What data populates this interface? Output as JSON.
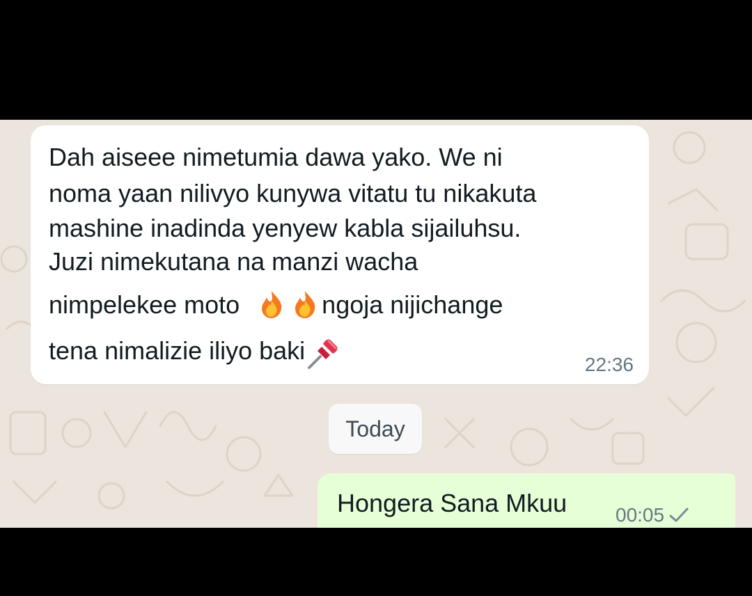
{
  "conversation": {
    "incoming": {
      "lines": [
        "Dah aiseee nimetumia dawa yako. We ni",
        "noma yaan nilivyo kunywa vitatu tu nikakuta",
        "mashine inadinda yenyew kabla sijailuhsu.",
        "Juzi nimekutana na manzi wacha",
        "nimpelekee moto",
        "ngoja nijichange",
        "tena nimalizie iliyo baki"
      ],
      "emojis": [
        "fire-emoji",
        "fire-emoji",
        "pushpin-emoji"
      ],
      "time": "22:36"
    },
    "date_separator": "Today",
    "outgoing": {
      "text": "Hongera Sana Mkuu",
      "time": "00:05",
      "status_icon": "single-check-icon"
    }
  },
  "colors": {
    "chat_background": "#ece5dd",
    "incoming_bubble": "#ffffff",
    "outgoing_bubble": "#e7ffd7",
    "timestamp": "#667781"
  }
}
